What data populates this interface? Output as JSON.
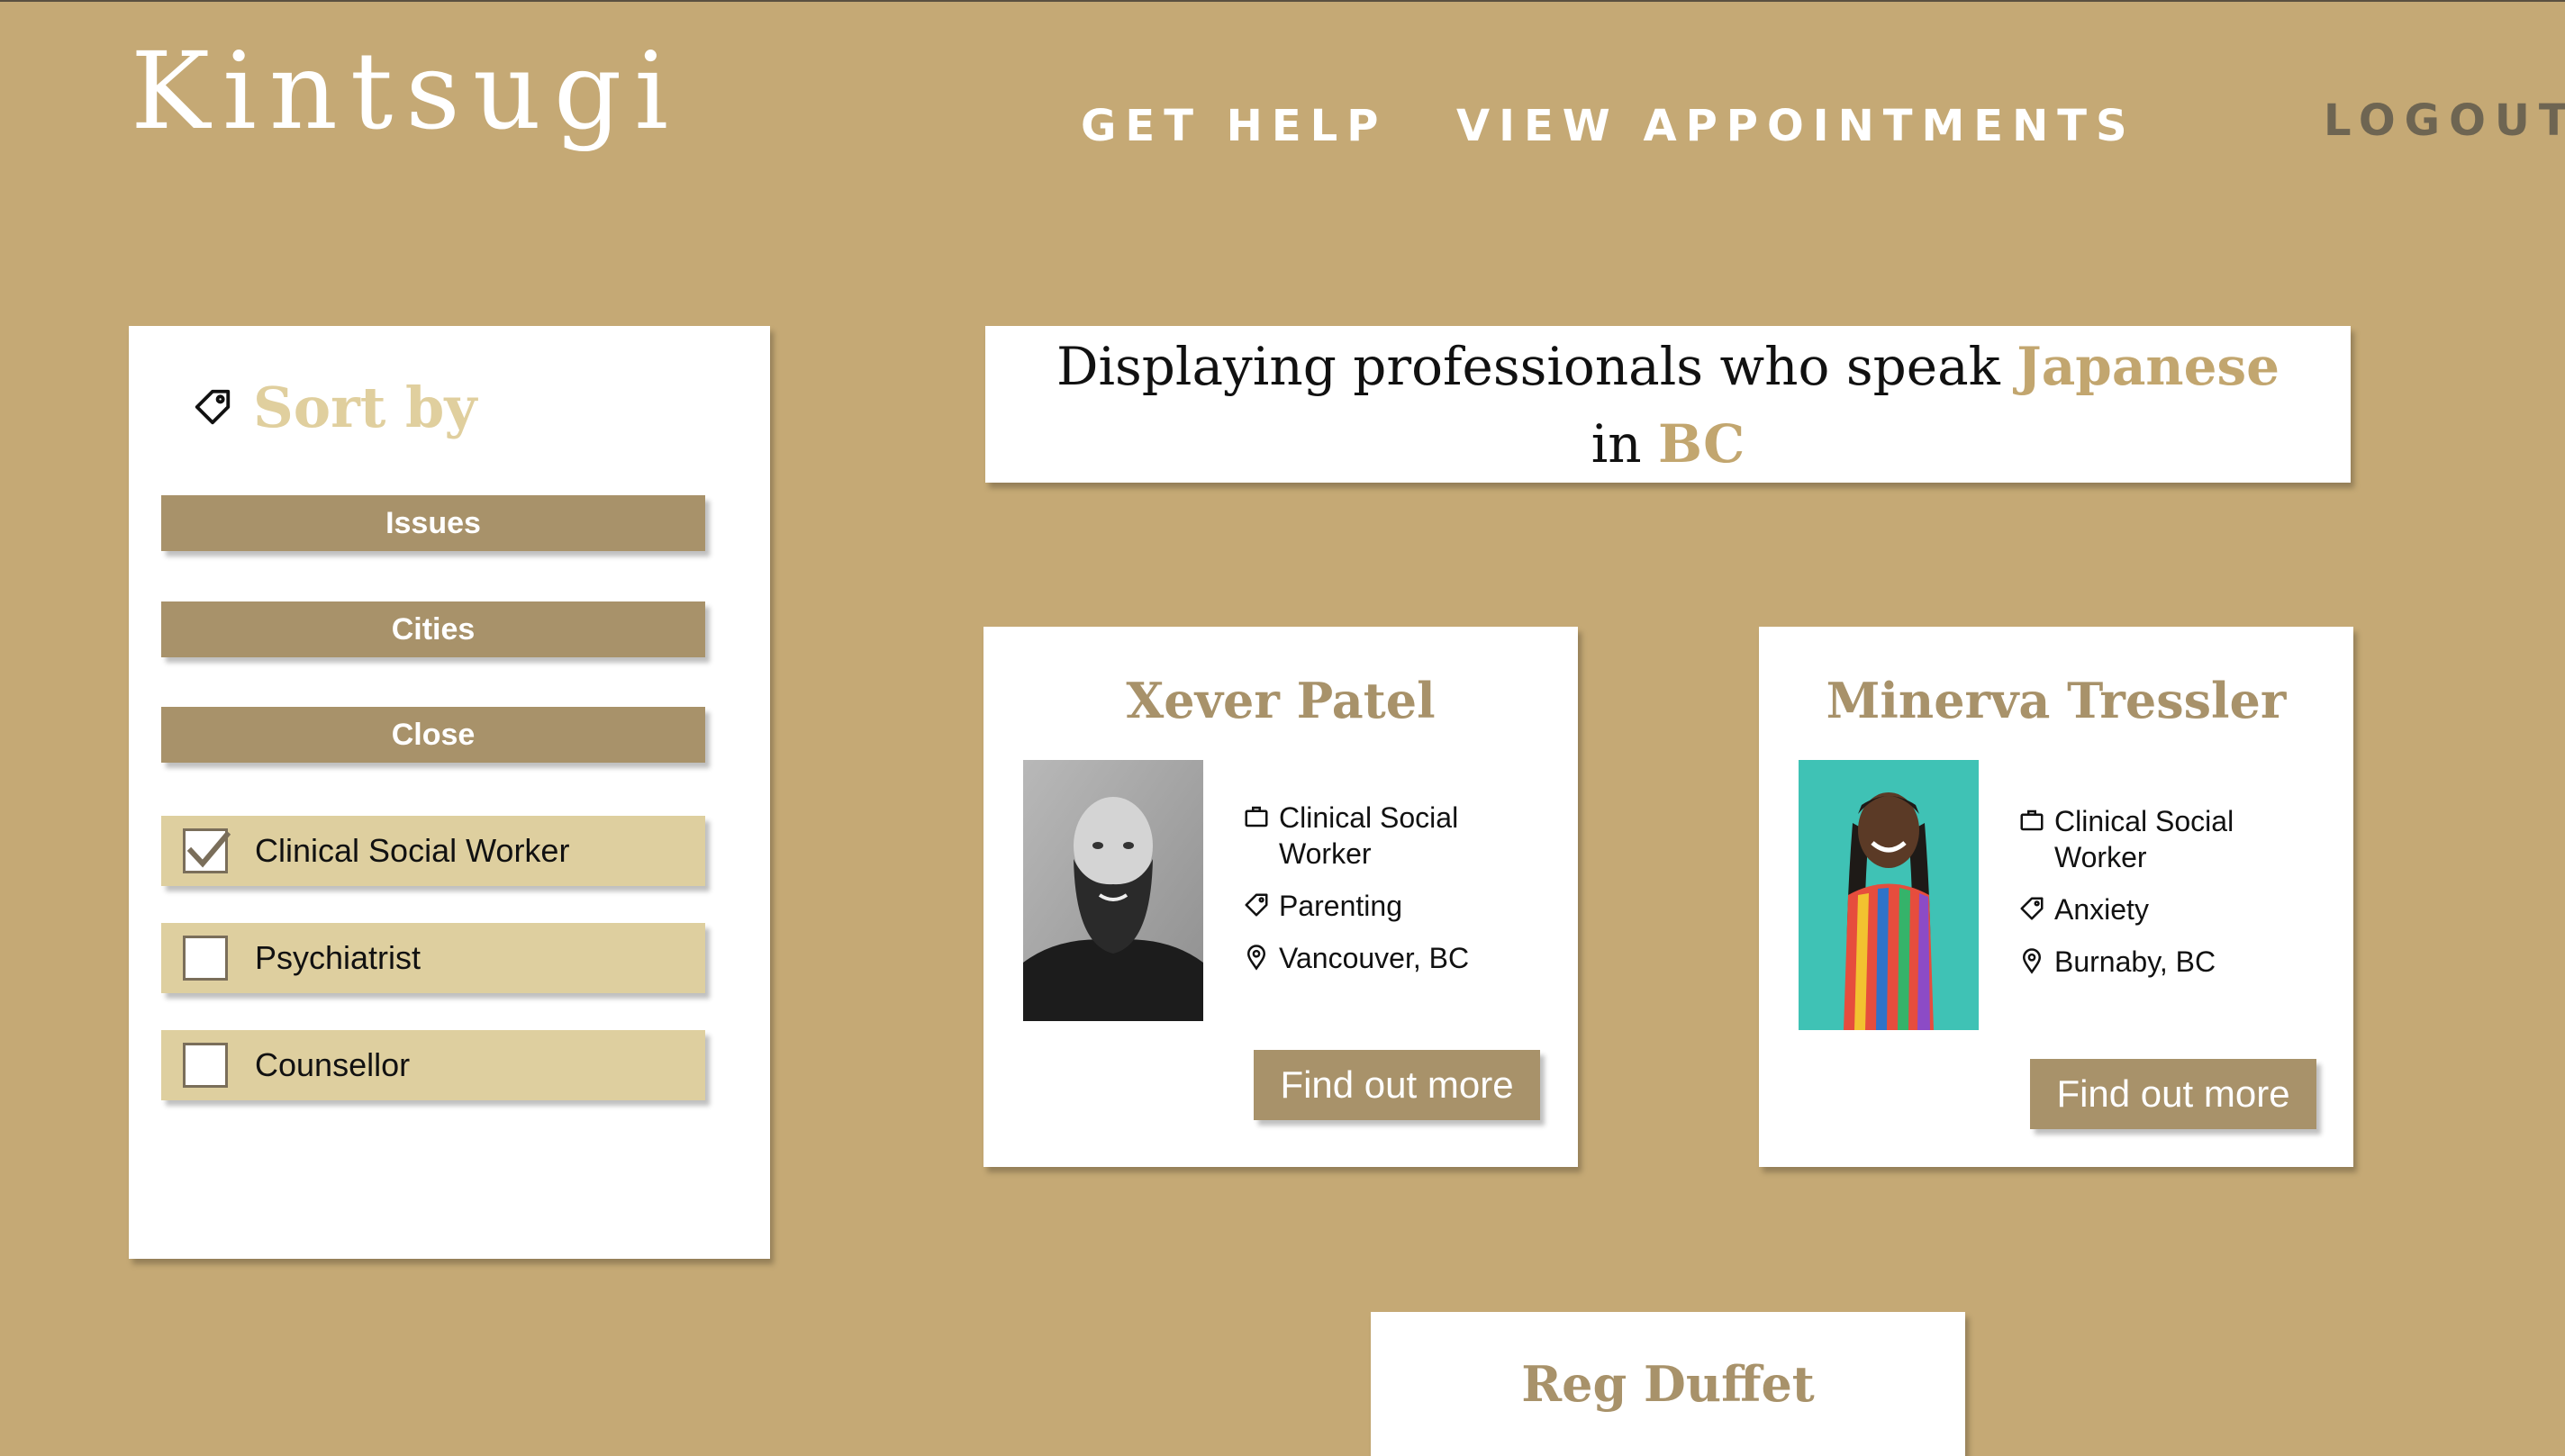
{
  "header": {
    "brand": "Kintsugi",
    "nav": {
      "get_help": "GET HELP",
      "view_appointments": "VIEW APPOINTMENTS",
      "logout": "LOGOUT"
    }
  },
  "sidebar": {
    "title": "Sort by",
    "title_icon": "tag-icon",
    "buttons": [
      "Issues",
      "Cities",
      "Close"
    ],
    "filters": [
      {
        "label": "Clinical Social Worker",
        "checked": true
      },
      {
        "label": "Psychiatrist",
        "checked": false
      },
      {
        "label": "Counsellor",
        "checked": false
      }
    ]
  },
  "banner": {
    "prefix": "Displaying professionals who speak",
    "language": "Japanese",
    "in_word": "in",
    "region": "BC"
  },
  "professionals": [
    {
      "name": "Xever Patel",
      "role": "Clinical Social Worker",
      "issue": "Parenting",
      "location": "Vancouver, BC",
      "button": "Find out more"
    },
    {
      "name": "Minerva Tressler",
      "role": "Clinical Social Worker",
      "issue": "Anxiety",
      "location": "Burnaby, BC",
      "button": "Find out more"
    },
    {
      "name": "Reg Duffet"
    }
  ],
  "colors": {
    "background": "#c5a975",
    "accent": "#c2a66f",
    "button": "#a8926a",
    "filter": "#decf9f",
    "sort_title": "#e0cf9e"
  }
}
